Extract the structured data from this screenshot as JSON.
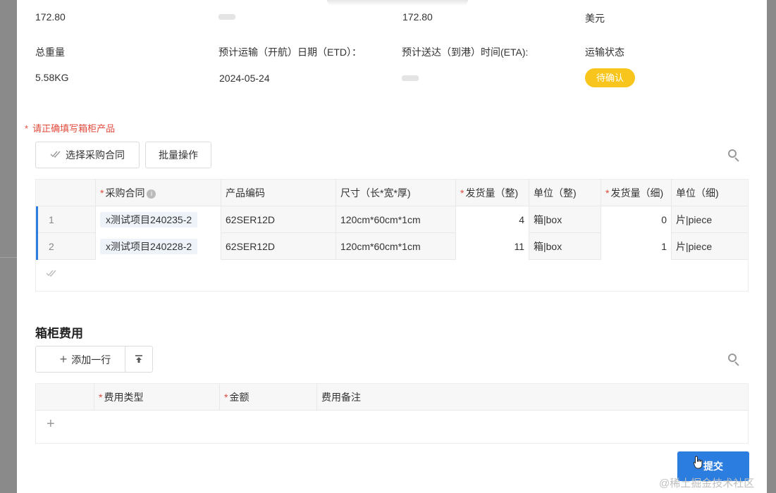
{
  "info": {
    "row1": {
      "col1": "172.80",
      "col3": "172.80",
      "col4": "美元"
    },
    "labels": {
      "total_weight": "总重量",
      "etd": "预计运输（开航）日期（ETD）：",
      "eta": "预计送达（到港）时间(ETA):",
      "status": "运输状态"
    },
    "values": {
      "total_weight": "5.58KG",
      "etd": "2024-05-24",
      "status": "待确认"
    }
  },
  "products": {
    "warning": "请正确填写箱柜产品",
    "warning_star": "*",
    "select_contract_label": "选择采购合同",
    "batch_label": "批量操作",
    "columns": [
      {
        "label": "采购合同",
        "required": "*",
        "info": "i"
      },
      {
        "label": "产品编码",
        "required": ""
      },
      {
        "label": "尺寸（长*宽*厚)",
        "required": ""
      },
      {
        "label": "发货量（整)",
        "required": "*"
      },
      {
        "label": "单位（整)",
        "required": ""
      },
      {
        "label": "发货量（细)",
        "required": "*"
      },
      {
        "label": "单位（细)",
        "required": ""
      }
    ],
    "rows": [
      {
        "index": "1",
        "contract": "x测试项目240235-2",
        "code": "62SER12D",
        "size": "120cm*60cm*1cm",
        "qty_whole": "4",
        "unit_whole": "箱|box",
        "qty_detail": "0",
        "unit_detail": "片|piece"
      },
      {
        "index": "2",
        "contract": "x测试项目240228-2",
        "code": "62SER12D",
        "size": "120cm*60cm*1cm",
        "qty_whole": "11",
        "unit_whole": "箱|box",
        "qty_detail": "1",
        "unit_detail": "片|piece"
      }
    ]
  },
  "fees": {
    "title": "箱柜费用",
    "add_row_label": "添加一行",
    "columns": [
      {
        "label": "费用类型",
        "required": "*"
      },
      {
        "label": "金额",
        "required": "*"
      },
      {
        "label": "费用备注",
        "required": ""
      }
    ]
  },
  "submit_label": "提交",
  "watermark": "@稀土掘金技术社区",
  "colors": {
    "primary": "#2b7de0",
    "status": "#f7c51b",
    "warning": "#e14a3c"
  }
}
